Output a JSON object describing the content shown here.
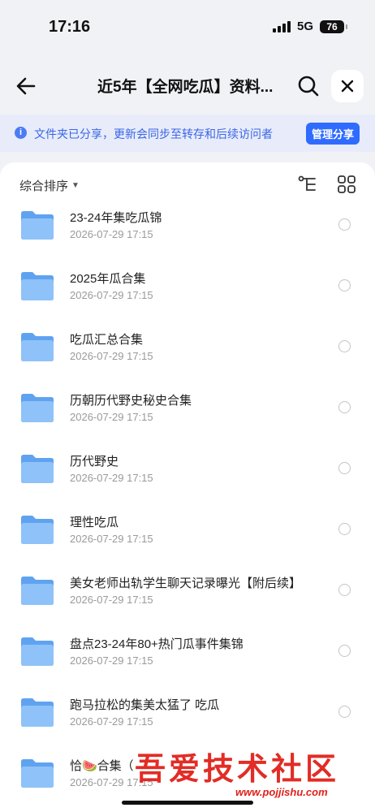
{
  "status_bar": {
    "time": "17:16",
    "network": "5G",
    "battery": "76"
  },
  "nav": {
    "title": "近5年【全网吃瓜】资料..."
  },
  "banner": {
    "text": "文件夹已分享，更新会同步至转存和后续访问者",
    "button": "管理分享",
    "icon_glyph": "i"
  },
  "toolbar": {
    "sort_label": "综合排序",
    "sort_caret": "▼"
  },
  "colors": {
    "accent": "#2f6bff",
    "folder": "#7cb5f5",
    "watermark": "#e1211a"
  },
  "icons": [
    "back-arrow-icon",
    "search-icon",
    "close-icon",
    "info-icon",
    "tree-view-icon",
    "grid-view-icon",
    "folder-icon"
  ],
  "files": [
    {
      "name": "23-24年集吃瓜锦",
      "date": "2026-07-29 17:15"
    },
    {
      "name": "2025年瓜合集",
      "date": "2026-07-29 17:15"
    },
    {
      "name": "吃瓜汇总合集",
      "date": "2026-07-29 17:15"
    },
    {
      "name": "历朝历代野史秘史合集",
      "date": "2026-07-29 17:15"
    },
    {
      "name": "历代野史",
      "date": "2026-07-29 17:15"
    },
    {
      "name": "理性吃瓜",
      "date": "2026-07-29 17:15"
    },
    {
      "name": "美女老师出轨学生聊天记录曝光【附后续】",
      "date": "2026-07-29 17:15"
    },
    {
      "name": "盘点23-24年80+热门瓜事件集锦",
      "date": "2026-07-29 17:15"
    },
    {
      "name": "跑马拉松的集美太猛了 吃瓜",
      "date": "2026-07-29 17:15"
    },
    {
      "name": "恰🍉合集（",
      "date": "2026-07-29 17:15"
    }
  ],
  "watermark": {
    "text": "吾爱技术社区",
    "url": "www.pojjishu.com"
  }
}
